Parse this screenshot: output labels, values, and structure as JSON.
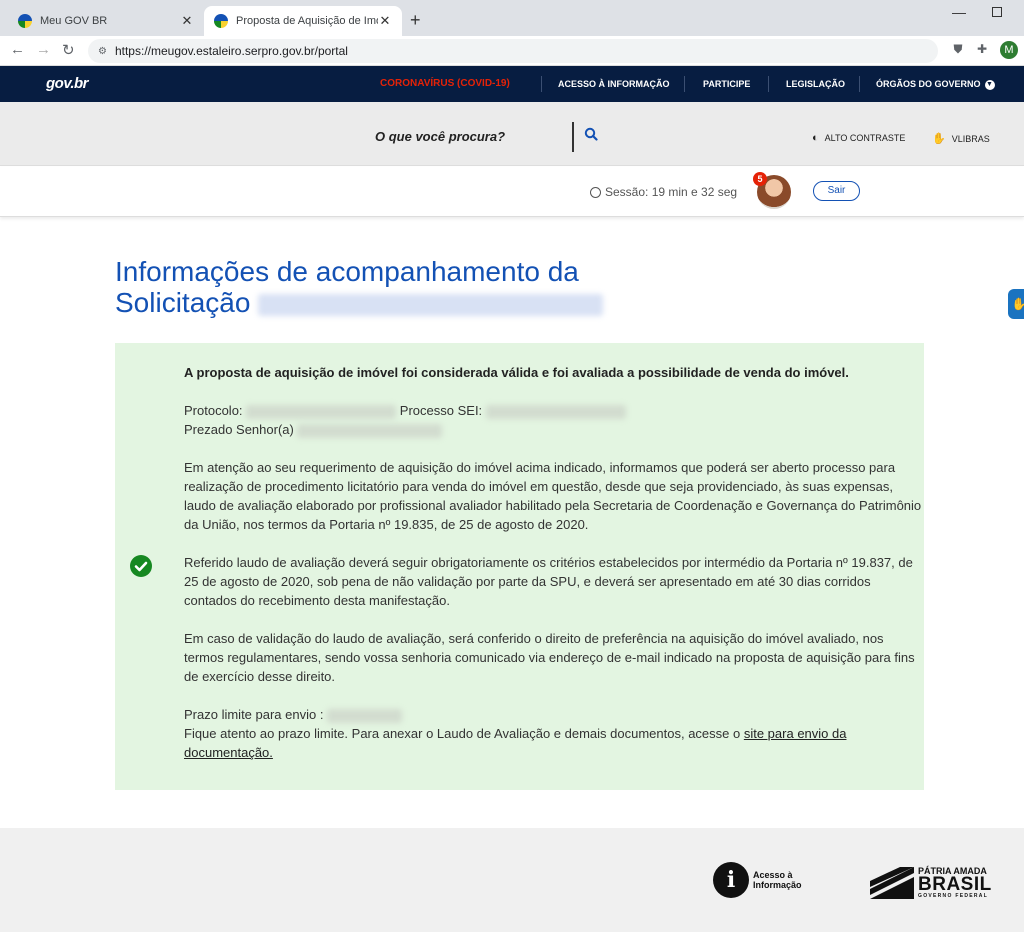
{
  "browser": {
    "tabs": [
      {
        "label": "Meu GOV BR"
      },
      {
        "label": "Proposta de Aquisição de Imóvel"
      }
    ],
    "url": "https://meugov.estaleiro.serpro.gov.br/portal",
    "profile_initial": "M"
  },
  "govnav": {
    "logo": "gov.br",
    "links": [
      "CORONAVÍRUS (COVID-19)",
      "ACESSO À INFORMAÇÃO",
      "PARTICIPE",
      "LEGISLAÇÃO",
      "ÓRGÃOS DO GOVERNO"
    ]
  },
  "search": {
    "placeholder": "O que você procura?",
    "high_contrast": "ALTO CONTRASTE",
    "vlibras": "VLIBRAS"
  },
  "user": {
    "session": "Sessão: 19 min e 32 seg",
    "notifications": "5",
    "logout": "Sair"
  },
  "main": {
    "title_line1": "Informações de acompanhamento da",
    "title_line2": "Solicitação"
  },
  "card": {
    "lead": "A proposta de aquisição de imóvel foi considerada válida e foi avaliada a possibilidade de venda do imóvel.",
    "protocolo_label": "Protocolo:",
    "processo_label": "Processo SEI:",
    "prezado_label": "Prezado Senhor(a)",
    "paragraph1": "Em atenção ao seu requerimento de aquisição do imóvel acima indicado, informamos que poderá ser aberto processo para realização de procedimento licitatório para venda do imóvel em questão, desde que seja providenciado, às suas expensas, laudo de avaliação elaborado por profissional avaliador habilitado pela Secretaria de Coordenação e Governança do Patrimônio da União, nos termos da Portaria nº 19.835, de 25 de agosto de 2020.",
    "paragraph2": "Referido laudo de avaliação deverá seguir obrigatoriamente os critérios estabelecidos por intermédio da Portaria nº 19.837, de 25 de agosto de 2020, sob pena de não validação por parte da SPU, e deverá ser apresentado em até 30 dias corridos contados do recebimento desta manifestação.",
    "paragraph3": "Em caso de validação do laudo de avaliação, será conferido o direito de preferência na aquisição do imóvel avaliado, nos termos regulamentares, sendo vossa senhoria comunicado via endereço de e-mail indicado na proposta de aquisição para fins de exercício desse direito.",
    "prazo_label": "Prazo limite para envio :",
    "fique_text": "Fique atento ao prazo limite. Para anexar o Laudo de Avaliação e demais documentos, acesse o ",
    "link_text": "site para envio da documentação."
  },
  "footer": {
    "acesso": "Acesso à Informação",
    "brasil_top": "PÁTRIA AMADA",
    "brasil_main": "BRASIL",
    "brasil_sub": "GOVERNO FEDERAL"
  }
}
